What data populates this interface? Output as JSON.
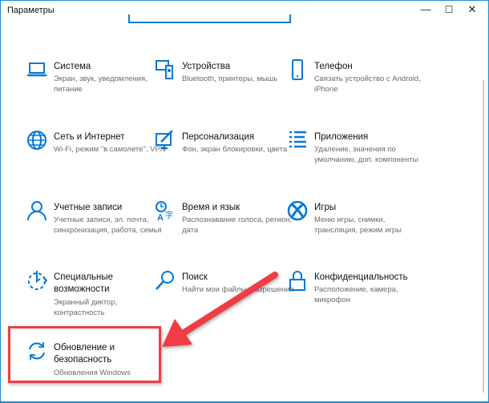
{
  "window": {
    "title": "Параметры",
    "minimize": "—",
    "maximize": "☐",
    "close": "✕"
  },
  "accent": "#0078d7",
  "annotation_color": "#ef3d45",
  "tiles": [
    {
      "title": "Система",
      "subtitle": "Экран, звук, уведомления, питание",
      "icon": "laptop-icon"
    },
    {
      "title": "Устройства",
      "subtitle": "Bluetooth, принтеры, мышь",
      "icon": "devices-icon"
    },
    {
      "title": "Телефон",
      "subtitle": "Связать устройство с Android, iPhone",
      "icon": "phone-icon"
    },
    {
      "title": "Сеть и Интернет",
      "subtitle": "Wi-Fi, режим \"в самолете\", VPN",
      "icon": "globe-icon"
    },
    {
      "title": "Персонализация",
      "subtitle": "Фон, экран блокировки, цвета",
      "icon": "personalization-icon"
    },
    {
      "title": "Приложения",
      "subtitle": "Удаление, значения по умолчанию, доп. компоненты",
      "icon": "apps-list-icon"
    },
    {
      "title": "Учетные записи",
      "subtitle": "Учетные записи, эл. почта, синхронизация, работа, семья",
      "icon": "person-icon"
    },
    {
      "title": "Время и язык",
      "subtitle": "Распознавание голоса, регион, дата",
      "icon": "time-language-icon"
    },
    {
      "title": "Игры",
      "subtitle": "Меню игры, снимки, трансляция, режим игры",
      "icon": "xbox-icon"
    },
    {
      "title": "Специальные возможности",
      "subtitle": "Экранный диктор, контрастность",
      "icon": "accessibility-icon"
    },
    {
      "title": "Поиск",
      "subtitle": "Найти мои файлы, разрешения",
      "icon": "search-icon"
    },
    {
      "title": "Конфиденциальность",
      "subtitle": "Расположение, камера, микрофон",
      "icon": "lock-icon"
    },
    {
      "title": "Обновление и безопасность",
      "subtitle": "Обновления Windows",
      "icon": "update-icon"
    }
  ]
}
